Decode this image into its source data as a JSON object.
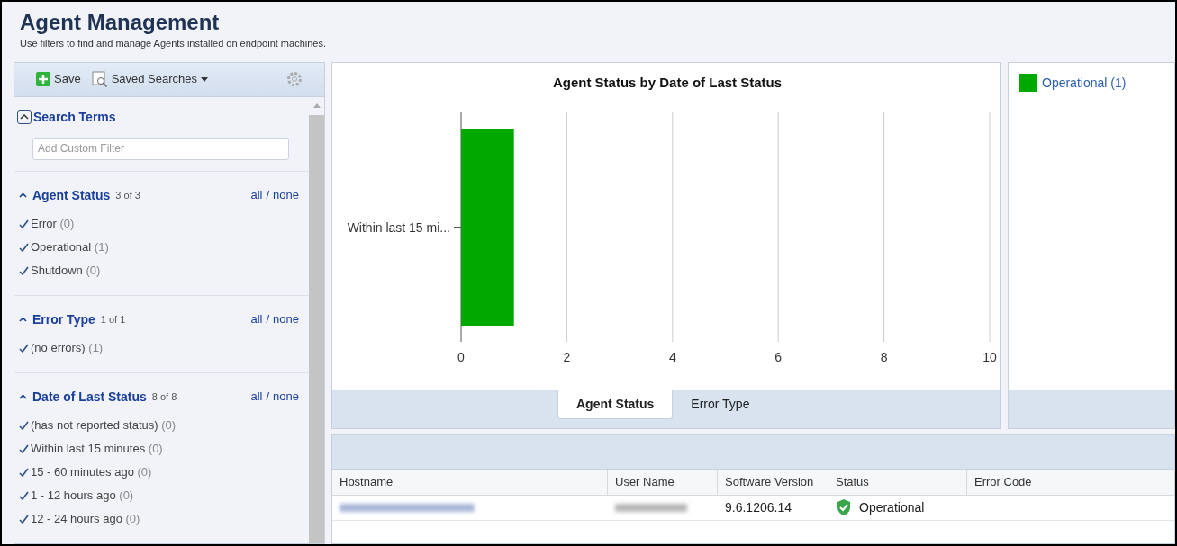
{
  "header": {
    "title": "Agent Management",
    "subtitle": "Use filters to find and manage Agents installed on endpoint machines."
  },
  "toolbar": {
    "save": "Save",
    "saved_searches": "Saved Searches"
  },
  "search_terms": {
    "title": "Search Terms",
    "expanded": true,
    "placeholder": "Add Custom Filter"
  },
  "filter_groups": [
    {
      "title": "Agent Status",
      "count": "3 of 3",
      "all": "all",
      "separator": "/",
      "none": "none",
      "items": [
        {
          "label": "Error",
          "count": "(0)",
          "checked": true
        },
        {
          "label": "Operational",
          "count": "(1)",
          "checked": true
        },
        {
          "label": "Shutdown",
          "count": "(0)",
          "checked": true
        }
      ]
    },
    {
      "title": "Error Type",
      "count": "1 of 1",
      "all": "all",
      "separator": "/",
      "none": "none",
      "items": [
        {
          "label": "(no errors)",
          "count": "(1)",
          "checked": true
        }
      ]
    },
    {
      "title": "Date of Last Status",
      "count": "8 of 8",
      "all": "all",
      "separator": "/",
      "none": "none",
      "items": [
        {
          "label": "(has not reported status)",
          "count": "(0)",
          "checked": true
        },
        {
          "label": "Within last 15 minutes",
          "count": "(0)",
          "checked": true
        },
        {
          "label": "15 - 60 minutes ago",
          "count": "(0)",
          "checked": true
        },
        {
          "label": "1 - 12 hours ago",
          "count": "(0)",
          "checked": true
        },
        {
          "label": "12 - 24 hours ago",
          "count": "(0)",
          "checked": true
        }
      ]
    }
  ],
  "chart": {
    "chart_data": {
      "type": "bar",
      "orientation": "horizontal",
      "title": "Agent Status by Date of Last Status",
      "categories": [
        "Within last 15 mi..."
      ],
      "series": [
        {
          "name": "Operational (1)",
          "color": "#00a800",
          "values": [
            1
          ]
        }
      ],
      "xlim": [
        0,
        10
      ],
      "xticks": [
        0,
        2,
        4,
        6,
        8,
        10
      ],
      "grid": true
    }
  },
  "chart_tabs": [
    {
      "label": "Agent Status",
      "selected": true
    },
    {
      "label": "Error Type",
      "selected": false
    }
  ],
  "table": {
    "columns": [
      "Hostname",
      "User Name",
      "Software Version",
      "Status",
      "Error Code"
    ],
    "rows": [
      {
        "cells": [
          {
            "kind": "redacted"
          },
          {
            "kind": "redacted"
          },
          {
            "kind": "text",
            "text": "9.6.1206.14"
          },
          {
            "kind": "status",
            "text": "Operational"
          }
        ]
      }
    ]
  }
}
